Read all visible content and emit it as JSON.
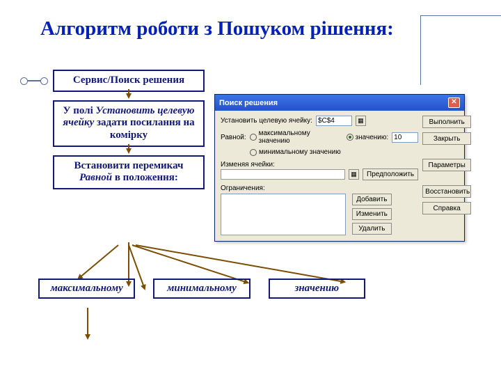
{
  "title": "Алгоритм роботи з Пошуком рішення:",
  "steps": {
    "s1": "Сервис/Поиск решения",
    "s2_a": "У полі ",
    "s2_b": "Установить целевую ячейку",
    "s2_c": " задати посилання на комірку",
    "s3_a": "Встановити перемикач ",
    "s3_b": "Равной",
    "s3_c": " в положення:"
  },
  "branches": {
    "max": "максимальному",
    "min": "минимальному",
    "val": "значению"
  },
  "dialog": {
    "title": "Поиск решения",
    "close_glyph": "✕",
    "target_label": "Установить целевую ячейку:",
    "target_value": "$C$4",
    "equal_label": "Равной:",
    "radio_max": "максимальному значению",
    "radio_min": "минимальному значению",
    "radio_val": "значению:",
    "val_value": "10",
    "cells_label": "Изменяя ячейки:",
    "suggest_btn": "Предположить",
    "constraints_label": "Ограничения:",
    "add_btn": "Добавить",
    "edit_btn": "Изменить",
    "del_btn": "Удалить",
    "run_btn": "Выполнить",
    "close_btn": "Закрыть",
    "params_btn": "Параметры",
    "reset_btn": "Восстановить",
    "help_btn": "Справка"
  }
}
